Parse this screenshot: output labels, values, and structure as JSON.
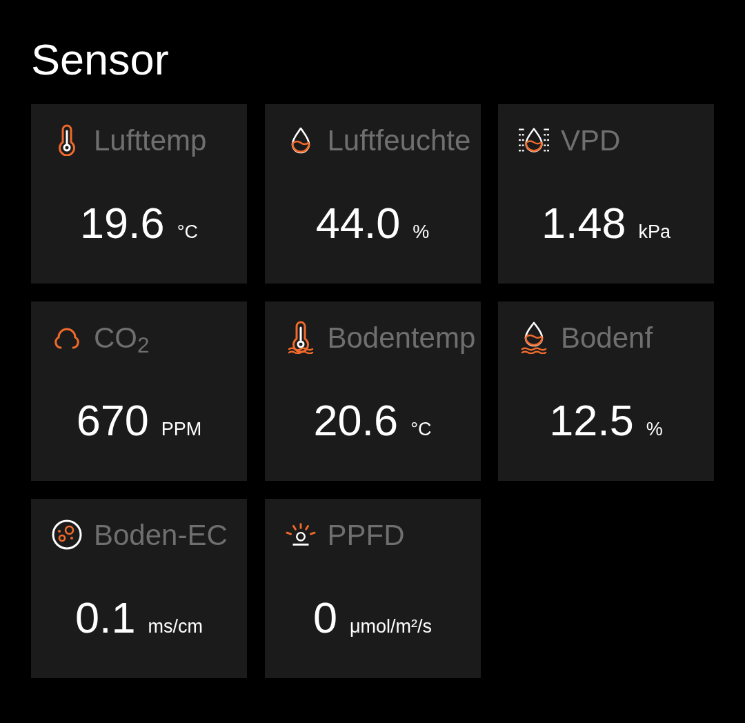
{
  "title": "Sensor",
  "cards": [
    {
      "kind": "air-temp",
      "label": "Lufttemp",
      "value": "19.6",
      "unit": "°C"
    },
    {
      "kind": "air-humidity",
      "label": "Luftfeuchte",
      "value": "44.0",
      "unit": "%"
    },
    {
      "kind": "vpd",
      "label": "VPD",
      "value": "1.48",
      "unit": "kPa"
    },
    {
      "kind": "co2",
      "label": "CO$_{2}$",
      "value": "670",
      "unit": "PPM"
    },
    {
      "kind": "soil-temp",
      "label": "Bodentemp",
      "value": "20.6",
      "unit": "°C"
    },
    {
      "kind": "soil-moisture",
      "label": "Bodenf",
      "value": "12.5",
      "unit": "%"
    },
    {
      "kind": "soil-ec",
      "label": "Boden-EC",
      "value": "0.1",
      "unit": "ms/cm"
    },
    {
      "kind": "ppfd",
      "label": "PPFD",
      "value": "0",
      "unit": "μmol/m²/s"
    }
  ]
}
